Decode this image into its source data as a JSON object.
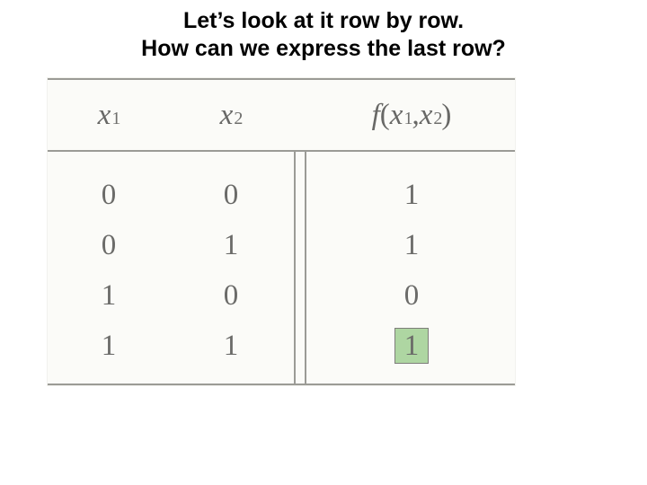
{
  "title_line1": "Let’s look at it row by row.",
  "title_line2": "How can we express the last row?",
  "headers": {
    "x1_var": "x",
    "x1_sub": "1",
    "x2_var": "x",
    "x2_sub": "2",
    "f_prefix": "f",
    "f_open": "(",
    "f_a_var": "x",
    "f_a_sub": "1",
    "f_comma": ", ",
    "f_b_var": "x",
    "f_b_sub": "2",
    "f_close": ")"
  },
  "rows": [
    {
      "x1": "0",
      "x2": "0",
      "f": "1"
    },
    {
      "x1": "0",
      "x2": "1",
      "f": "1"
    },
    {
      "x1": "1",
      "x2": "0",
      "f": "0"
    },
    {
      "x1": "1",
      "x2": "1",
      "f": "1"
    }
  ],
  "chart_data": {
    "type": "table",
    "columns": [
      "x1",
      "x2",
      "f(x1,x2)"
    ],
    "data": [
      [
        0,
        0,
        1
      ],
      [
        0,
        1,
        1
      ],
      [
        1,
        0,
        0
      ],
      [
        1,
        1,
        1
      ]
    ],
    "highlighted_cell": {
      "row": 3,
      "col": 2
    }
  }
}
